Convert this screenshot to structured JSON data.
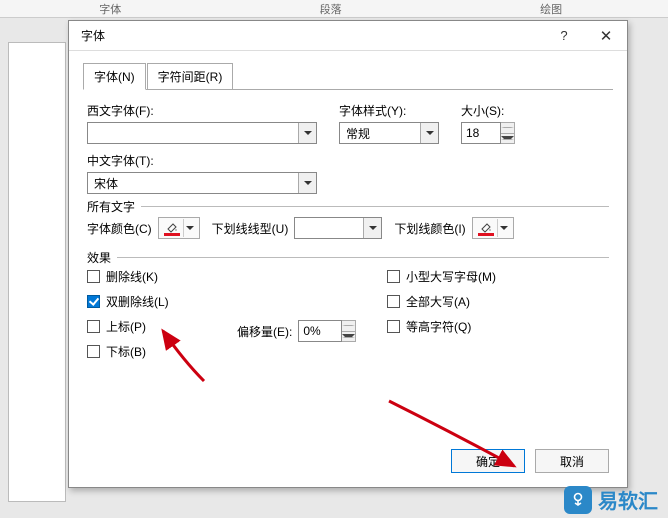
{
  "ribbon": {
    "group1": "字体",
    "group2": "段落",
    "group3": "绘图"
  },
  "dialog": {
    "title": "字体",
    "tabs": {
      "font": "字体(N)",
      "spacing": "字符间距(R)"
    },
    "western_label": "西文字体(F):",
    "western_value": "",
    "style_label": "字体样式(Y):",
    "style_value": "常规",
    "size_label": "大小(S):",
    "size_value": "18",
    "chinese_label": "中文字体(T):",
    "chinese_value": "宋体",
    "all_text": "所有文字",
    "font_color_label": "字体颜色(C)",
    "underline_type_label": "下划线线型(U)",
    "underline_type_value": "",
    "underline_color_label": "下划线颜色(I)",
    "effects": "效果",
    "strike": "删除线(K)",
    "dstrike": "双删除线(L)",
    "superscript": "上标(P)",
    "subscript": "下标(B)",
    "offset_label": "偏移量(E):",
    "offset_value": "0%",
    "smallcaps": "小型大写字母(M)",
    "allcaps": "全部大写(A)",
    "equalize": "等高字符(Q)",
    "ok": "确定",
    "cancel": "取消"
  },
  "watermark": "易软汇"
}
